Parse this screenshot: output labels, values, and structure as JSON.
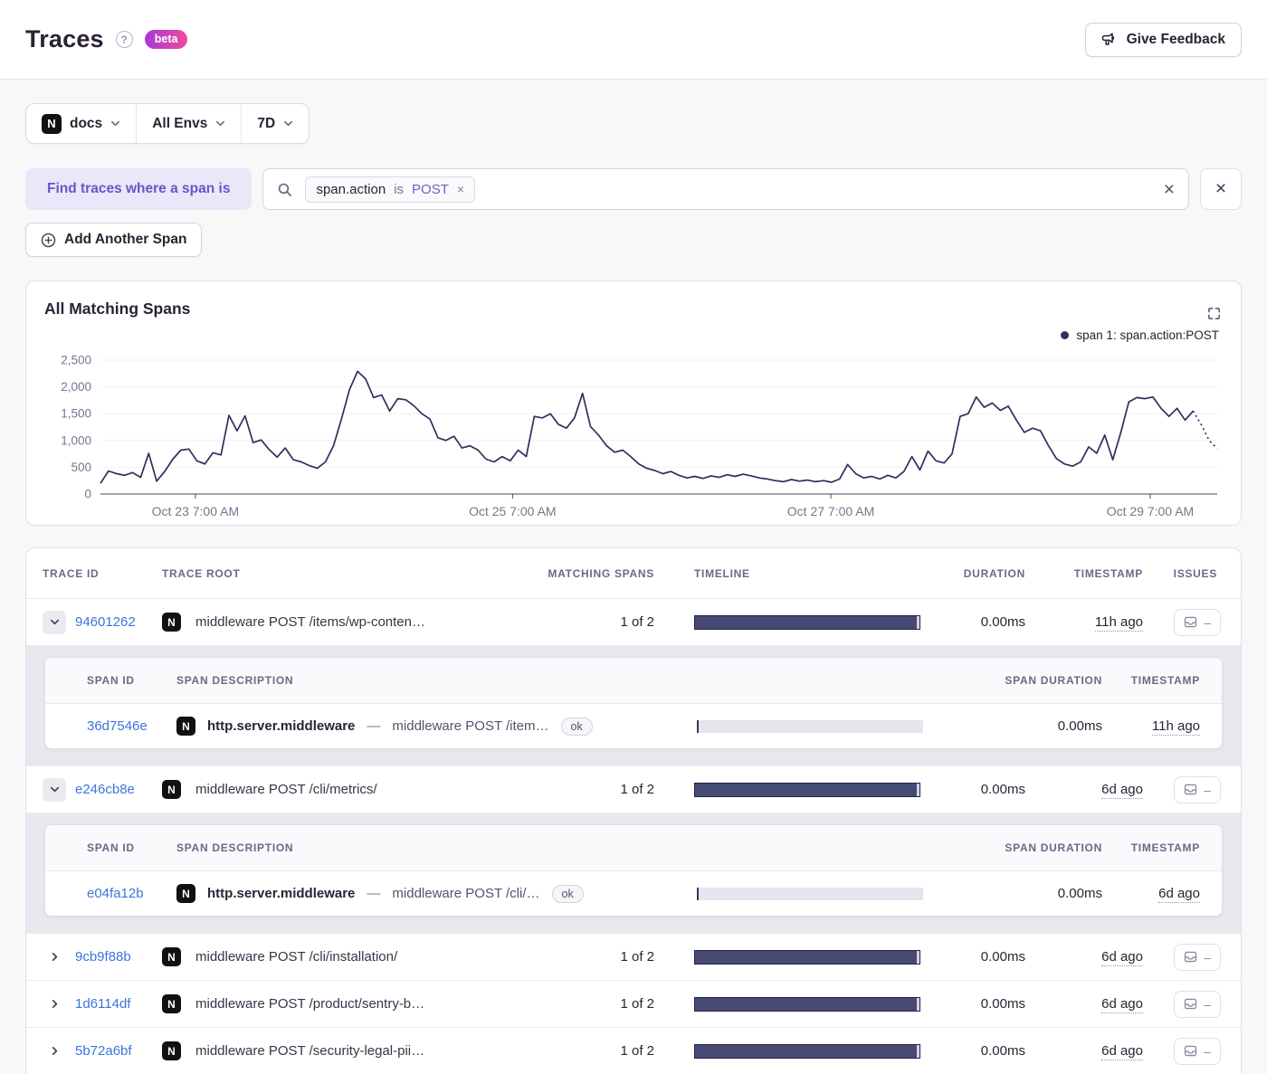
{
  "header": {
    "title": "Traces",
    "beta_label": "beta",
    "feedback_label": "Give Feedback"
  },
  "filters": {
    "project": "docs",
    "environment": "All Envs",
    "period": "7D"
  },
  "span_query": {
    "find_label": "Find traces where a span is",
    "token": {
      "key": "span.action",
      "operator": "is",
      "value": "POST",
      "remove": "×"
    },
    "clear": "×",
    "remove_filter": "×",
    "add_span_label": "Add Another Span"
  },
  "chart": {
    "title": "All Matching Spans",
    "legend": "span 1: span.action:POST"
  },
  "chart_data": {
    "type": "line",
    "title": "All Matching Spans",
    "ylabel": "",
    "xlabel": "",
    "ylim": [
      0,
      2500
    ],
    "y_ticks": [
      0,
      500,
      1000,
      1500,
      2000,
      2500
    ],
    "x_ticks": {
      "labels": [
        "Oct 23 7:00 AM",
        "Oct 25 7:00 AM",
        "Oct 27 7:00 AM",
        "Oct 29 7:00 AM"
      ],
      "fractions": [
        0.085,
        0.369,
        0.654,
        0.94
      ]
    },
    "grid": "horizontal",
    "legend_position": "top-right",
    "line_color": "#332d5c",
    "dashed_tail_points": 3,
    "series": [
      {
        "name": "span 1: span.action:POST",
        "values": [
          200,
          430,
          380,
          350,
          400,
          310,
          760,
          240,
          420,
          650,
          820,
          840,
          620,
          560,
          770,
          730,
          1470,
          1180,
          1460,
          960,
          1010,
          830,
          690,
          860,
          640,
          600,
          530,
          480,
          600,
          900,
          1400,
          1950,
          2290,
          2150,
          1800,
          1850,
          1550,
          1780,
          1760,
          1650,
          1500,
          1400,
          1050,
          1000,
          1080,
          860,
          900,
          820,
          650,
          600,
          700,
          620,
          820,
          700,
          1450,
          1420,
          1500,
          1300,
          1230,
          1420,
          1880,
          1260,
          1100,
          900,
          780,
          820,
          700,
          560,
          480,
          440,
          380,
          420,
          350,
          300,
          330,
          290,
          340,
          310,
          360,
          330,
          370,
          340,
          300,
          280,
          250,
          230,
          270,
          240,
          260,
          230,
          250,
          220,
          280,
          550,
          380,
          300,
          330,
          280,
          350,
          300,
          420,
          700,
          450,
          800,
          620,
          580,
          750,
          1450,
          1500,
          1810,
          1620,
          1700,
          1560,
          1640,
          1380,
          1150,
          1230,
          1180,
          900,
          660,
          560,
          520,
          600,
          880,
          760,
          1100,
          640,
          1150,
          1720,
          1800,
          1780,
          1810,
          1600,
          1450,
          1600,
          1380,
          1550,
          1300,
          1000,
          850
        ]
      }
    ]
  },
  "table": {
    "columns": {
      "trace_id": "TRACE ID",
      "trace_root": "TRACE ROOT",
      "matching_spans": "MATCHING SPANS",
      "timeline": "TIMELINE",
      "duration": "DURATION",
      "timestamp": "TIMESTAMP",
      "issues": "ISSUES"
    },
    "span_columns": {
      "span_id": "SPAN ID",
      "span_description": "SPAN DESCRIPTION",
      "span_duration": "SPAN DURATION",
      "timestamp": "TIMESTAMP"
    },
    "issues_placeholder": "–",
    "desc_separator": "—",
    "rows": [
      {
        "id": "94601262",
        "root": "middleware POST /items/wp-conten…",
        "matching": "1 of 2",
        "duration": "0.00ms",
        "timestamp": "11h ago",
        "spans": [
          {
            "id": "36d7546e",
            "op": "http.server.middleware",
            "desc": "middleware POST /item…",
            "status": "ok",
            "duration": "0.00ms",
            "timestamp": "11h ago"
          }
        ]
      },
      {
        "id": "e246cb8e",
        "root": "middleware POST /cli/metrics/",
        "matching": "1 of 2",
        "duration": "0.00ms",
        "timestamp": "6d ago",
        "spans": [
          {
            "id": "e04fa12b",
            "op": "http.server.middleware",
            "desc": "middleware POST /cli/…",
            "status": "ok",
            "duration": "0.00ms",
            "timestamp": "6d ago"
          }
        ]
      },
      {
        "id": "9cb9f88b",
        "root": "middleware POST /cli/installation/",
        "matching": "1 of 2",
        "duration": "0.00ms",
        "timestamp": "6d ago"
      },
      {
        "id": "1d6114df",
        "root": "middleware POST /product/sentry-b…",
        "matching": "1 of 2",
        "duration": "0.00ms",
        "timestamp": "6d ago"
      },
      {
        "id": "5b72a6bf",
        "root": "middleware POST /security-legal-pii…",
        "matching": "1 of 2",
        "duration": "0.00ms",
        "timestamp": "6d ago"
      }
    ]
  }
}
